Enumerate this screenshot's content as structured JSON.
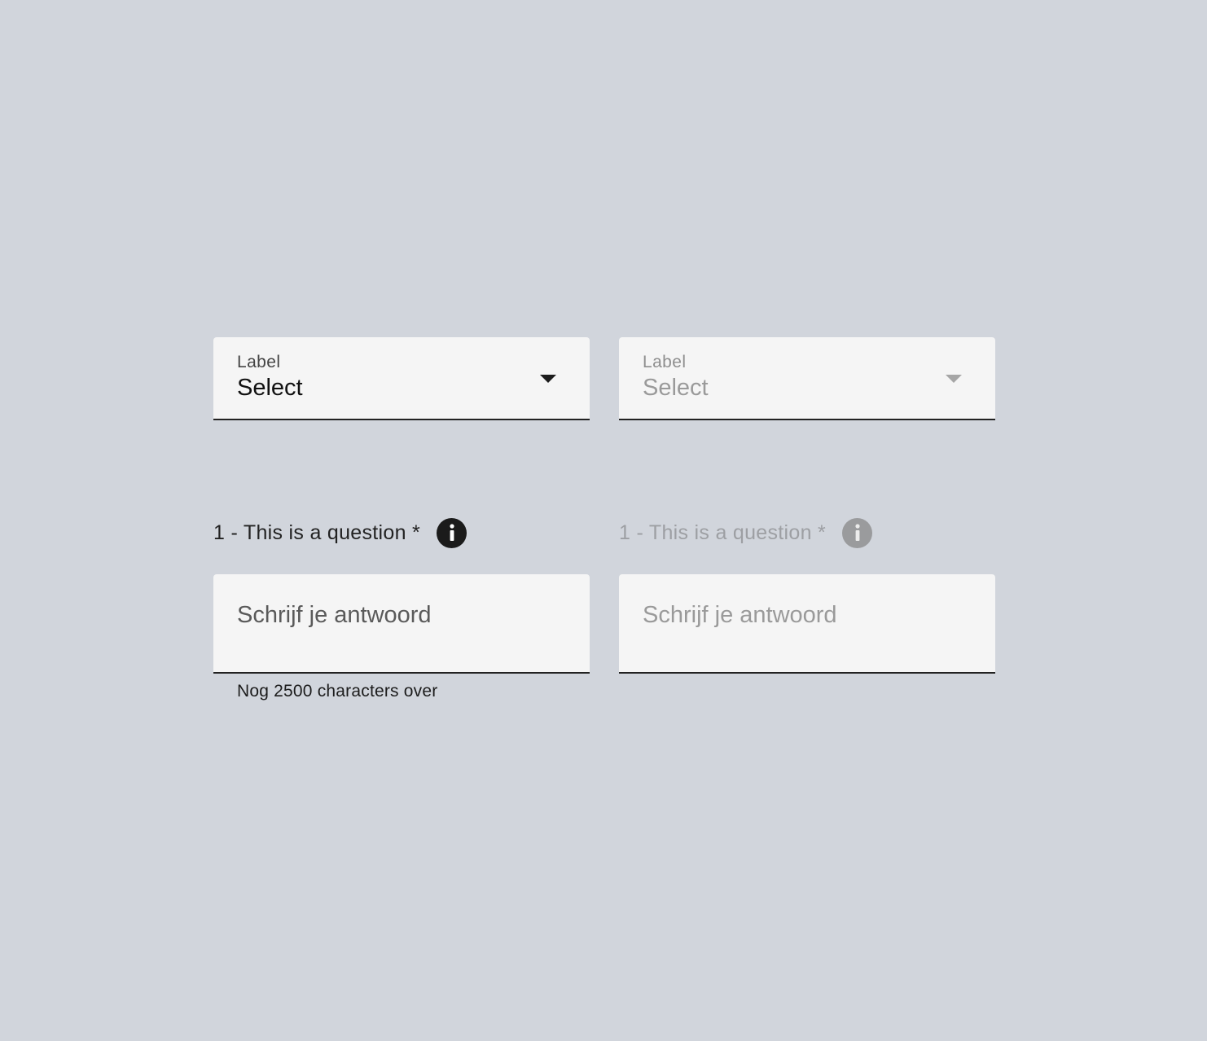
{
  "select_enabled": {
    "label": "Label",
    "value": "Select",
    "icon": "caret-down-icon"
  },
  "select_disabled": {
    "label": "Label",
    "value": "Select",
    "icon": "caret-down-icon"
  },
  "question_enabled": {
    "text": "1 - This is a question *",
    "icon": "info-icon"
  },
  "question_disabled": {
    "text": "1 - This is a question *",
    "icon": "info-icon"
  },
  "textarea_enabled": {
    "placeholder": "Schrijf je antwoord",
    "helper": "Nog 2500 characters over"
  },
  "textarea_disabled": {
    "placeholder": "Schrijf je antwoord"
  },
  "colors": {
    "background": "#d1d5dc",
    "field": "#f5f5f5",
    "text": "#111111",
    "disabled_text": "#9a9a9a"
  }
}
